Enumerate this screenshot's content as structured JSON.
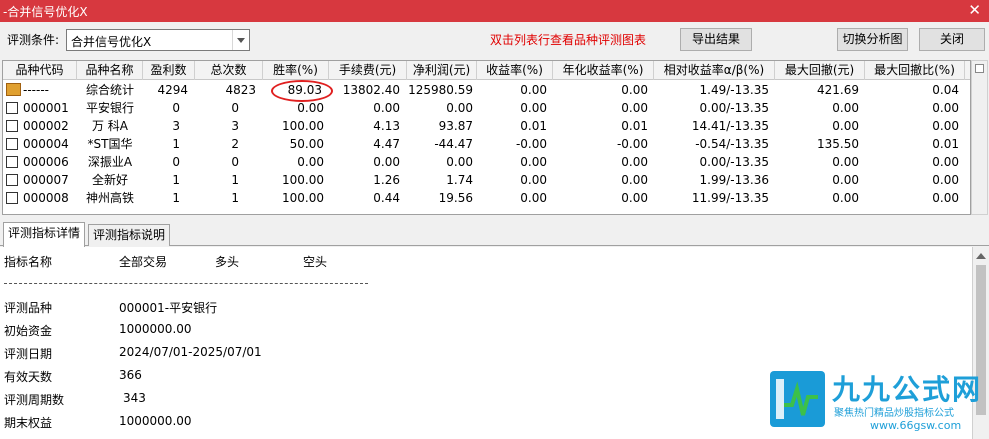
{
  "window": {
    "title": "-合并信号优化X",
    "close_glyph": "✕"
  },
  "toolbar": {
    "condition_label": "评测条件:",
    "condition_value": "合并信号优化X",
    "hint": "双击列表行查看品种评测图表",
    "export_label": "导出结果",
    "switch_label": "切换分析图",
    "close_label": "关闭"
  },
  "table": {
    "columns": [
      "品种代码",
      "品种名称",
      "盈利数",
      "总次数",
      "胜率(%)",
      "手续费(元)",
      "净利润(元)",
      "收益率(%)",
      "年化收益率(%)",
      "相对收益率α/β(%)",
      "最大回撤(元)",
      "最大回撤比(%)"
    ],
    "rows": [
      {
        "icon": "summary-icon",
        "cells": [
          "------",
          "综合统计",
          "4294",
          "4823",
          "89.03",
          "13802.40",
          "125980.59",
          "0.00",
          "0.00",
          "1.49/-13.35",
          "421.69",
          "0.04"
        ]
      },
      {
        "icon": "stock-icon",
        "cells": [
          "000001",
          "平安银行",
          "0",
          "0",
          "0.00",
          "0.00",
          "0.00",
          "0.00",
          "0.00",
          "0.00/-13.35",
          "0.00",
          "0.00"
        ]
      },
      {
        "icon": "stock-icon",
        "cells": [
          "000002",
          "万 科A",
          "3",
          "3",
          "100.00",
          "4.13",
          "93.87",
          "0.01",
          "0.01",
          "14.41/-13.35",
          "0.00",
          "0.00"
        ]
      },
      {
        "icon": "stock-icon",
        "cells": [
          "000004",
          "*ST国华",
          "1",
          "2",
          "50.00",
          "4.47",
          "-44.47",
          "-0.00",
          "-0.00",
          "-0.54/-13.35",
          "135.50",
          "0.01"
        ]
      },
      {
        "icon": "stock-icon",
        "cells": [
          "000006",
          "深振业A",
          "0",
          "0",
          "0.00",
          "0.00",
          "0.00",
          "0.00",
          "0.00",
          "0.00/-13.35",
          "0.00",
          "0.00"
        ]
      },
      {
        "icon": "stock-icon",
        "cells": [
          "000007",
          "全新好",
          "1",
          "1",
          "100.00",
          "1.26",
          "1.74",
          "0.00",
          "0.00",
          "1.99/-13.36",
          "0.00",
          "0.00"
        ]
      },
      {
        "icon": "stock-icon",
        "cells": [
          "000008",
          "神州高铁",
          "1",
          "1",
          "100.00",
          "0.44",
          "19.56",
          "0.00",
          "0.00",
          "11.99/-13.35",
          "0.00",
          "0.00"
        ]
      }
    ]
  },
  "tabs": [
    {
      "label": "评测指标详情",
      "active": true
    },
    {
      "label": "评测指标说明",
      "active": false
    }
  ],
  "detail": {
    "header": [
      "指标名称",
      "全部交易",
      "多头",
      "空头"
    ],
    "items": [
      {
        "label": "评测品种",
        "value": "000001-平安银行"
      },
      {
        "label": "初始资金",
        "value": "1000000.00"
      },
      {
        "label": "评测日期",
        "value": "2024/07/01-2025/07/01"
      },
      {
        "label": "有效天数",
        "value": "366"
      },
      {
        "label": "评测周期数",
        "value": "343"
      },
      {
        "label": "期末权益",
        "value": "1000000.00"
      }
    ]
  },
  "logo": {
    "brand": "九九公式网",
    "slogan": "聚焦热门精品炒股指标公式",
    "url": "www.66gsw.com"
  },
  "colors": {
    "titlebar": "#d7383f",
    "hint": "#e00000",
    "highlight_circle": "#e02020",
    "logo": "#1e9fd8"
  }
}
